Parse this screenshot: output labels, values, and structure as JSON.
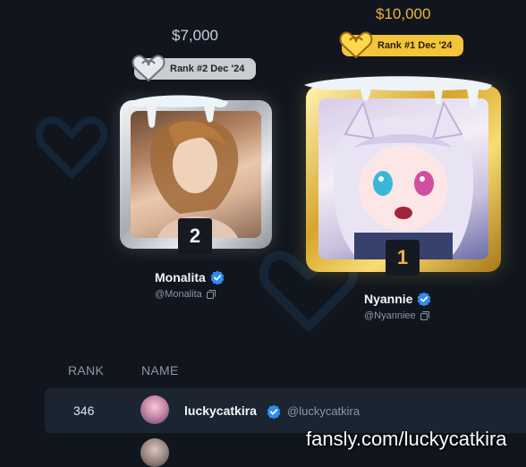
{
  "podium": [
    {
      "position": "2",
      "prize": "$7,000",
      "rank_label": "Rank #2 Dec '24",
      "name": "Monalita",
      "handle": "@Monalita"
    },
    {
      "position": "1",
      "prize": "$10,000",
      "rank_label": "Rank #1 Dec '24",
      "name": "Nyannie",
      "handle": "@Nyanniee"
    }
  ],
  "table": {
    "headers": {
      "rank": "RANK",
      "name": "NAME"
    },
    "rows": [
      {
        "rank": "346",
        "name": "luckycatkira",
        "handle": "@luckycatkira"
      }
    ]
  },
  "watermark": "fansly.com/luckycatkira",
  "colors": {
    "background": "#11161e",
    "gold": "#f0b33a",
    "silver": "#c9ccd1",
    "verified": "#2d8cf0",
    "row_highlight": "#1b2532"
  },
  "icons": {
    "badge_heart": "heart-chain-icon",
    "verified": "verified-check-icon",
    "copy": "copy-icon"
  }
}
